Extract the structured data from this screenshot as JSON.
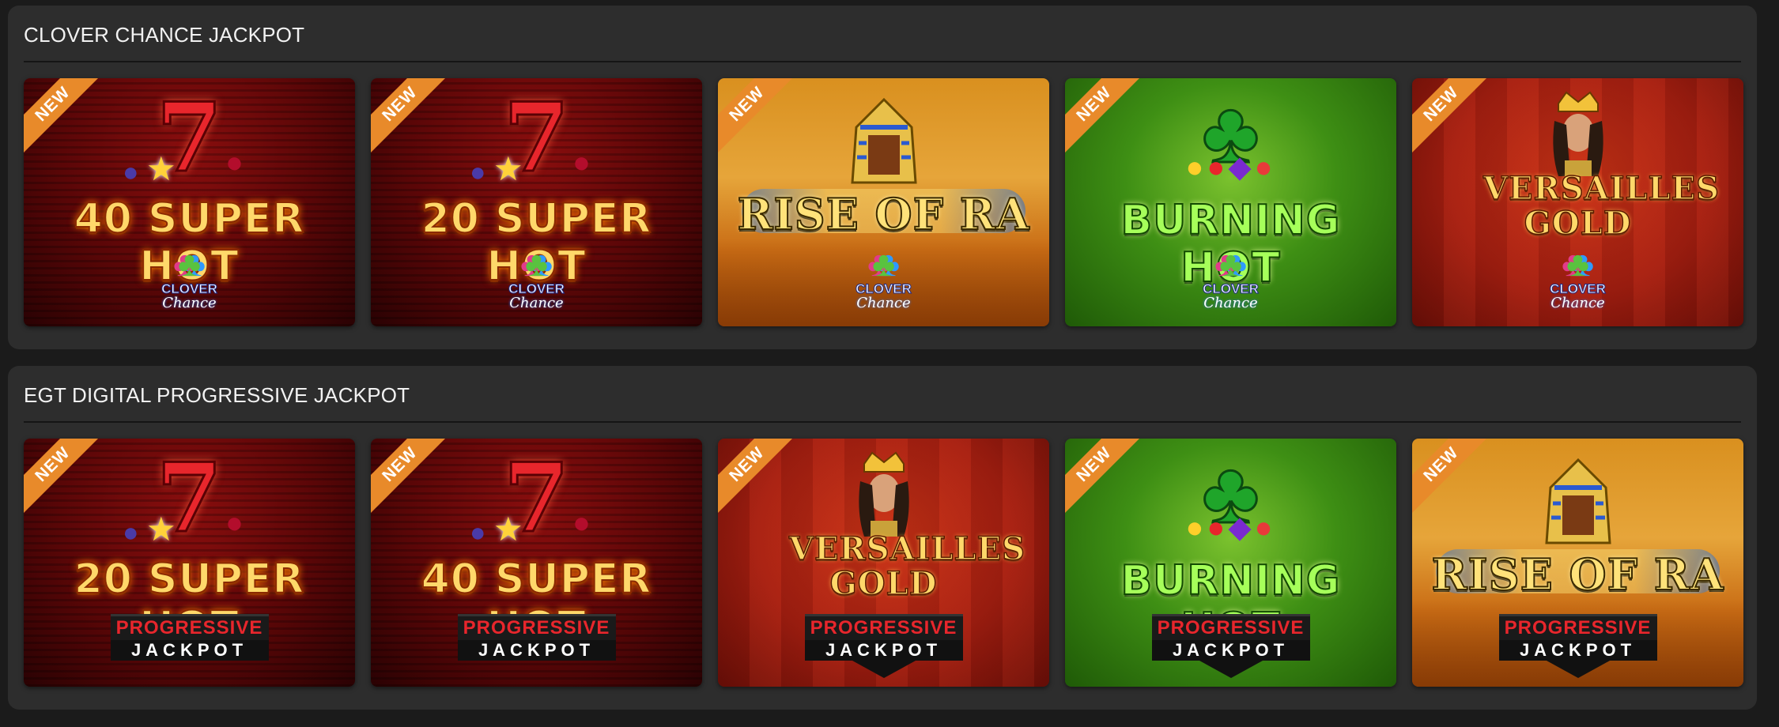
{
  "sections": [
    {
      "title": "CLOVER CHANCE JACKPOT",
      "games": [
        {
          "name": "40 SUPER HOT",
          "badge": "NEW",
          "logo": "CLOVER",
          "logo2": "Chance"
        },
        {
          "name": "20 SUPER HOT",
          "badge": "NEW",
          "logo": "CLOVER",
          "logo2": "Chance"
        },
        {
          "name": "RISE OF RA",
          "badge": "NEW",
          "logo": "CLOVER",
          "logo2": "Chance"
        },
        {
          "name": "BURNING HOT",
          "badge": "NEW",
          "logo": "CLOVER",
          "logo2": "Chance"
        },
        {
          "name": "VERSAILLES GOLD",
          "badge": "NEW",
          "logo": "CLOVER",
          "logo2": "Chance"
        }
      ]
    },
    {
      "title": "EGT DIGITAL PROGRESSIVE JACKPOT",
      "games": [
        {
          "name": "20 SUPER HOT",
          "badge": "NEW",
          "logo": "PROGRESSIVE",
          "logo2": "JACKPOT"
        },
        {
          "name": "40 SUPER HOT",
          "badge": "NEW",
          "logo": "PROGRESSIVE",
          "logo2": "JACKPOT"
        },
        {
          "name": "VERSAILLES GOLD",
          "badge": "NEW",
          "logo": "PROGRESSIVE",
          "logo2": "JACKPOT"
        },
        {
          "name": "BURNING HOT",
          "badge": "NEW",
          "logo": "PROGRESSIVE",
          "logo2": "JACKPOT"
        },
        {
          "name": "RISE OF RA",
          "badge": "NEW",
          "logo": "PROGRESSIVE",
          "logo2": "JACKPOT"
        }
      ]
    }
  ],
  "colors": {
    "page_bg": "#1b1b1b",
    "panel_bg": "#2d2d2d",
    "badge": "#e88a2a",
    "title_text": "#f2f2f2"
  }
}
